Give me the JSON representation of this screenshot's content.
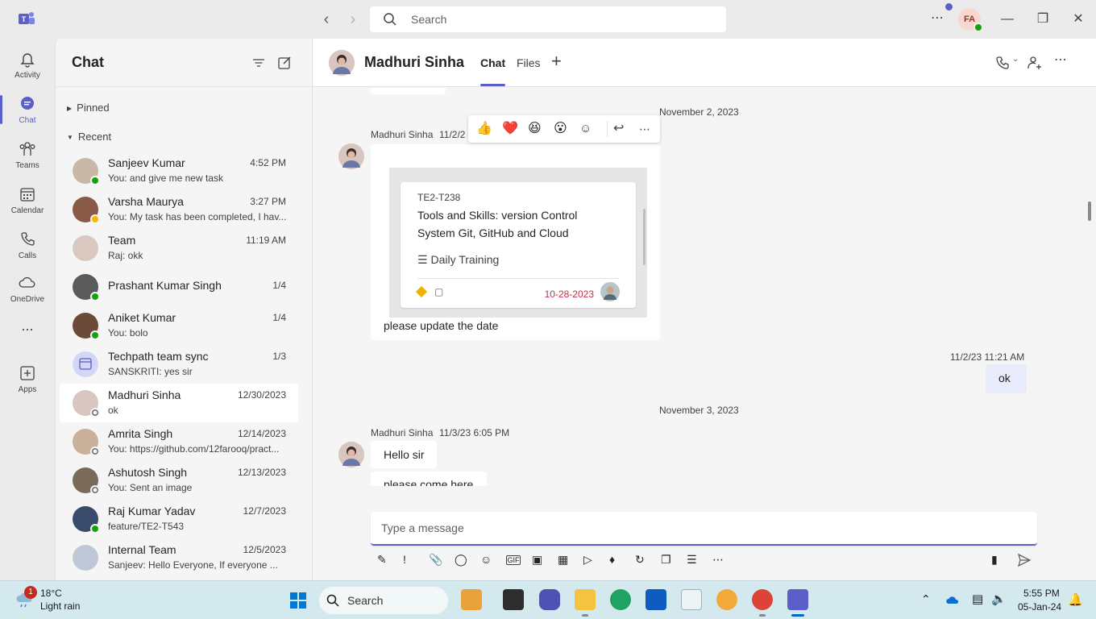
{
  "titlebar": {
    "search_placeholder": "Search",
    "account_initials": "FA"
  },
  "rail": {
    "items": [
      {
        "label": "Activity",
        "icon": "bell-icon"
      },
      {
        "label": "Chat",
        "icon": "chat-icon"
      },
      {
        "label": "Teams",
        "icon": "teams-icon"
      },
      {
        "label": "Calendar",
        "icon": "calendar-icon"
      },
      {
        "label": "Calls",
        "icon": "phone-icon"
      },
      {
        "label": "OneDrive",
        "icon": "cloud-icon"
      },
      {
        "label": "...",
        "icon": "more-icon"
      },
      {
        "label": "Apps",
        "icon": "apps-icon"
      }
    ]
  },
  "chatlist": {
    "title": "Chat",
    "pinned_label": "Pinned",
    "recent_label": "Recent",
    "chats": [
      {
        "name": "Sanjeev Kumar",
        "time": "4:52 PM",
        "preview": "You: and give me new task",
        "presence": "available"
      },
      {
        "name": "Varsha Maurya",
        "time": "3:27 PM",
        "preview": "You: My task has been completed, I hav...",
        "presence": "away"
      },
      {
        "name": "Team",
        "time": "11:19 AM",
        "preview": "Raj: okk",
        "presence": "none"
      },
      {
        "name": "Prashant Kumar Singh",
        "time": "1/4",
        "preview": "",
        "presence": "available"
      },
      {
        "name": "Aniket Kumar",
        "time": "1/4",
        "preview": "You: bolo",
        "presence": "available"
      },
      {
        "name": "Techpath team sync",
        "time": "1/3",
        "preview": "SANSKRITI: yes sir",
        "presence": "none"
      },
      {
        "name": "Madhuri Sinha",
        "time": "12/30/2023",
        "preview": "ok",
        "presence": "offline"
      },
      {
        "name": "Amrita Singh",
        "time": "12/14/2023",
        "preview": "You: https://github.com/12farooq/pract...",
        "presence": "offline"
      },
      {
        "name": "Ashutosh Singh",
        "time": "12/13/2023",
        "preview": "You: Sent an image",
        "presence": "offline"
      },
      {
        "name": "Raj Kumar Yadav",
        "time": "12/7/2023",
        "preview": "feature/TE2-T543",
        "presence": "available"
      },
      {
        "name": "Internal Team",
        "time": "12/5/2023",
        "preview": "Sanjeev: Hello Everyone,    If everyone ...",
        "presence": "none"
      }
    ]
  },
  "conversation": {
    "contact_name": "Madhuri Sinha",
    "tabs": [
      "Chat",
      "Files"
    ],
    "date_sep_1": "November 2, 2023",
    "msg1_author": "Madhuri Sinha",
    "msg1_time": "11/2/2",
    "reactions": [
      "👍",
      "❤️",
      "😆",
      "😮"
    ],
    "card": {
      "id": "TE2-T238",
      "title": "Tools and Skills: version Control System Git, GitHub and Cloud",
      "bucket": "Daily Training",
      "due": "10-28-2023"
    },
    "msg1_text": "please update the date",
    "mine_time": "11/2/23 11:21 AM",
    "mine_text": "ok",
    "date_sep_2": "November 3, 2023",
    "msg2_author": "Madhuri Sinha",
    "msg2_time": "11/3/23 6:05 PM",
    "msg2_text": "Hello sir",
    "msg3_text": "please come here",
    "composer_placeholder": "Type a message"
  },
  "taskbar": {
    "weather_badge": "1",
    "temperature": "18°C",
    "condition": "Light rain",
    "search_label": "Search",
    "time": "5:55 PM",
    "date": "05-Jan-24"
  },
  "colors": {
    "accent": "#5b5fc7",
    "available": "#13a10e",
    "away": "#f8b500",
    "due_date": "#c4314b"
  }
}
